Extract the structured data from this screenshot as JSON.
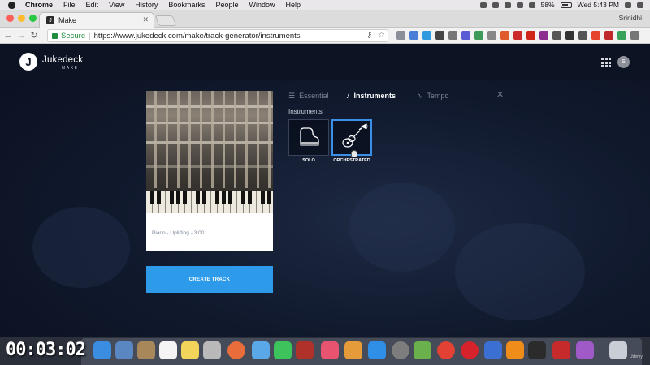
{
  "menubar": {
    "items": [
      "Chrome",
      "File",
      "Edit",
      "View",
      "History",
      "Bookmarks",
      "People",
      "Window",
      "Help"
    ],
    "battery": "58%",
    "clock": "Wed 5:43 PM"
  },
  "browser": {
    "tab_title": "Make",
    "profile": "Srinidhi",
    "secure_label": "Secure",
    "url": "https://www.jukedeck.com/make/track-generator/instruments"
  },
  "app": {
    "logo_letter": "J",
    "logo_text": "Jukedeck",
    "logo_sub": "MAKE",
    "avatar_initial": "S"
  },
  "card": {
    "caption": "Piano - Uplifting - 3:00"
  },
  "create_button": "CREATE TRACK",
  "panel": {
    "tabs": [
      {
        "label": "Essential",
        "icon": "sliders-icon",
        "active": false
      },
      {
        "label": "Instruments",
        "icon": "guitar-icon",
        "active": true
      },
      {
        "label": "Tempo",
        "icon": "pulse-icon",
        "active": false
      }
    ],
    "section_label": "Instruments",
    "options": [
      {
        "label": "SOLO",
        "icon": "piano-icon",
        "selected": false
      },
      {
        "label": "ORCHESTRATED",
        "icon": "guitar-icon",
        "selected": true
      }
    ]
  },
  "video": {
    "timer": "00:03:02",
    "watermark": "Udemy"
  }
}
